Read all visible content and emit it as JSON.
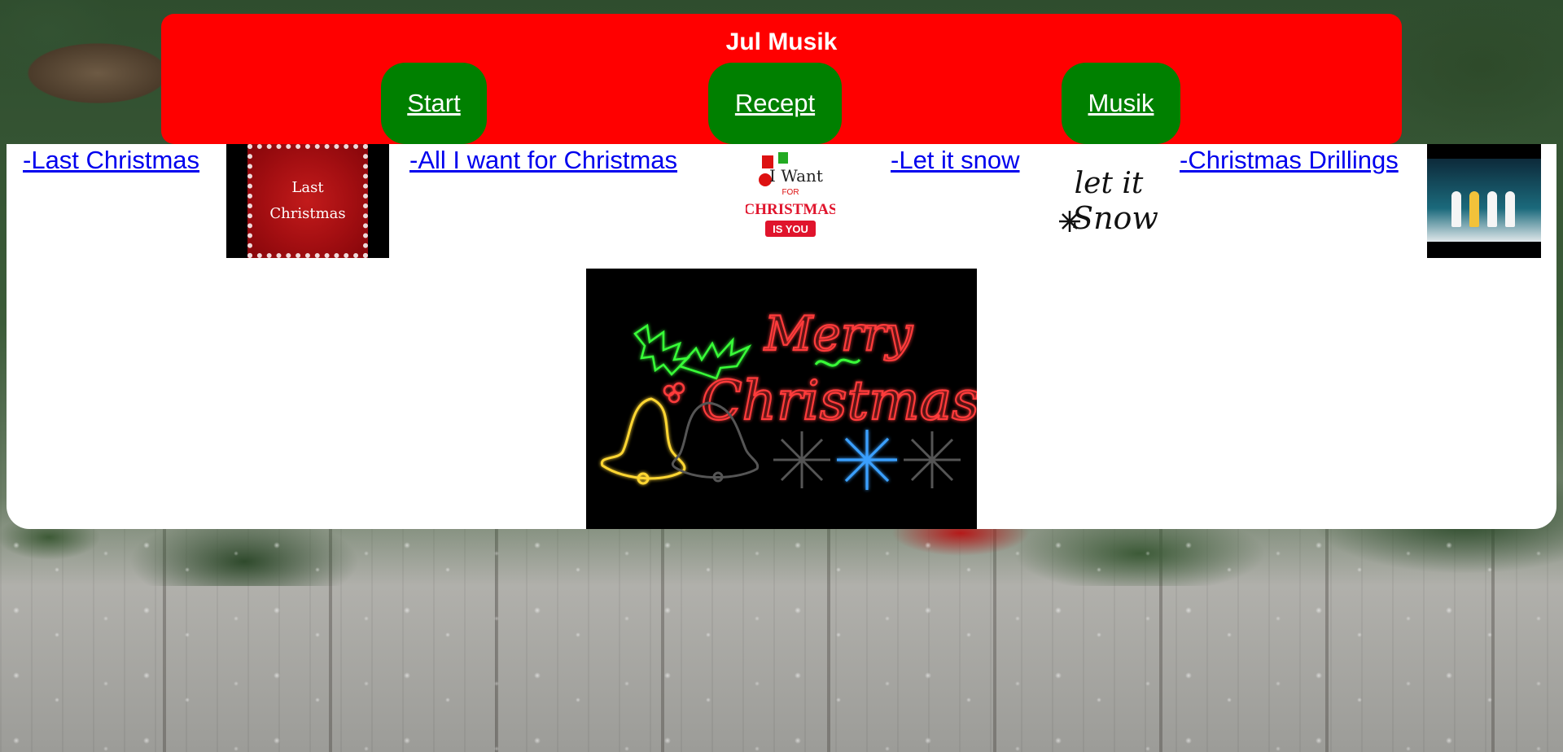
{
  "header": {
    "title": "Jul Musik",
    "nav": [
      "Start",
      "Recept",
      "Musik"
    ]
  },
  "songs": [
    {
      "label": "-Last Christmas",
      "thumb_text": [
        "Last",
        "Christmas"
      ]
    },
    {
      "label": "-All I want for Christmas",
      "thumb_text": [
        "I Want",
        "FOR",
        "CHRISTMAS",
        "IS YOU"
      ]
    },
    {
      "label": "-Let it snow",
      "thumb_text": [
        "let it",
        "Snow"
      ]
    },
    {
      "label": "-Christmas Drillings"
    }
  ],
  "banner": {
    "lines": [
      "Merry",
      "Christmas"
    ]
  },
  "colors": {
    "header_bg": "#ff0000",
    "nav_bg": "#008000",
    "link": "#0000ee",
    "neon_red": "#ff3b3b",
    "neon_green": "#39ff39",
    "neon_yellow": "#ffd633",
    "neon_blue": "#3aa0ff"
  }
}
